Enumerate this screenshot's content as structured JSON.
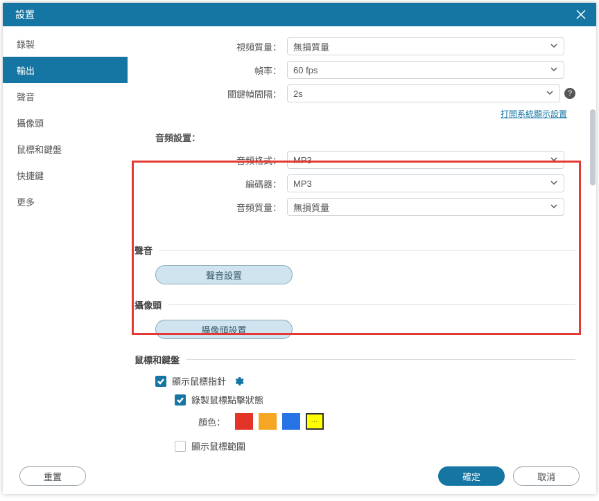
{
  "title": "設置",
  "sidebar": {
    "items": [
      {
        "label": "錄製"
      },
      {
        "label": "輸出"
      },
      {
        "label": "聲音"
      },
      {
        "label": "攝像頭"
      },
      {
        "label": "鼠標和鍵盤"
      },
      {
        "label": "快捷鍵"
      },
      {
        "label": "更多"
      }
    ],
    "active_index": 1
  },
  "video": {
    "quality_label": "視頻質量：",
    "quality_value": "無損質量",
    "fps_label": "幀率：",
    "fps_value": "60 fps",
    "keyframe_label": "關鍵幀間隔：",
    "keyframe_value": "2s"
  },
  "display_settings_link": "打開系統顯示設置",
  "audio": {
    "heading": "音頻設置：",
    "format_label": "音頻格式：",
    "format_value": "MP3",
    "encoder_label": "編碼器：",
    "encoder_value": "MP3",
    "quality_label": "音頻質量：",
    "quality_value": "無損質量"
  },
  "sections": {
    "sound": {
      "heading": "聲音",
      "button": "聲音設置"
    },
    "camera": {
      "heading": "攝像頭",
      "button": "攝像頭設置"
    },
    "mouse": {
      "heading": "鼠標和鍵盤",
      "show_pointer": "顯示鼠標指針",
      "record_clicks": "錄製鼠標點擊狀態",
      "color_label": "顏色：",
      "show_range": "顯示鼠標範圍"
    }
  },
  "colors": {
    "red": "#e43327",
    "orange": "#f5a623",
    "blue": "#2773e6",
    "more_label": "⋯"
  },
  "footer": {
    "reset": "重置",
    "ok": "確定",
    "cancel": "取消"
  }
}
